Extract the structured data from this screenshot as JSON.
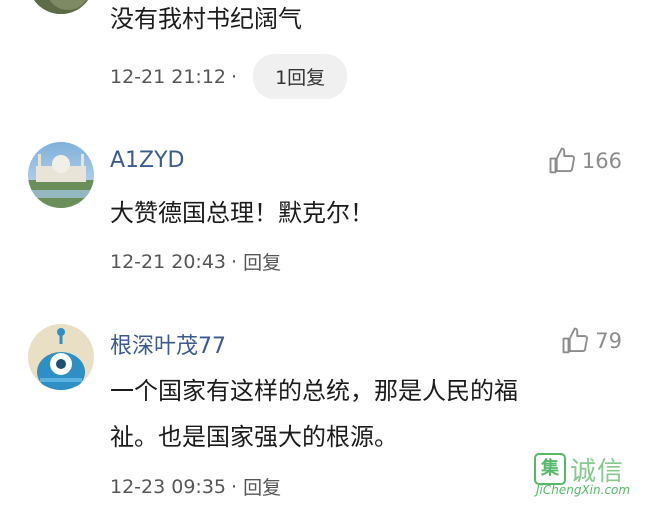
{
  "comments": [
    {
      "content_lines": [
        "没有我村书纪阔气"
      ],
      "time": "12-21 21:12",
      "separator": "·",
      "reply_label": "1回复"
    },
    {
      "username": "A1ZYD",
      "likes": "166",
      "content_lines": [
        "大赞德国总理！默克尔！"
      ],
      "time": "12-21 20:43",
      "separator": "·",
      "reply_label": "回复"
    },
    {
      "username": "根深叶茂77",
      "likes": "79",
      "content_lines": [
        "一个国家有这样的总统，那是人民的福",
        "祉。也是国家强大的根源。"
      ],
      "time": "12-23 09:35",
      "separator": "·",
      "reply_label": "回复"
    }
  ],
  "watermark": {
    "brand": "诚信",
    "url": "JiChengXin.com"
  },
  "colors": {
    "username": "#3b5b8e",
    "meta": "#555555",
    "like": "#8c8c8c",
    "watermark": "#58b86a"
  }
}
